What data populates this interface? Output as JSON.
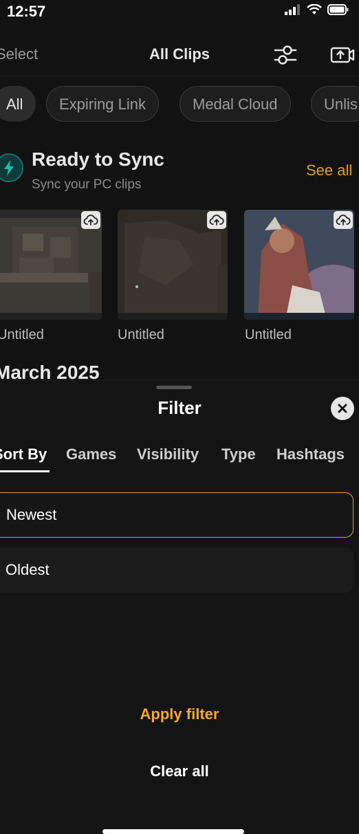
{
  "status": {
    "time": "12:57"
  },
  "nav": {
    "select": "Select",
    "title": "All Clips"
  },
  "chips": [
    {
      "label": "All"
    },
    {
      "label": "Expiring Link"
    },
    {
      "label": "Medal Cloud"
    },
    {
      "label": "Unlis"
    }
  ],
  "sync": {
    "title": "Ready to Sync",
    "subtitle": "Sync your PC clips",
    "see_all": "See all",
    "clips": [
      {
        "title": "Untitled"
      },
      {
        "title": "Untitled"
      },
      {
        "title": "Untitled"
      }
    ]
  },
  "month": "March 2025",
  "filter": {
    "title": "Filter",
    "tabs": [
      {
        "label": "Sort By"
      },
      {
        "label": "Games"
      },
      {
        "label": "Visibility"
      },
      {
        "label": "Type"
      },
      {
        "label": "Hashtags"
      }
    ],
    "active_tab": "Sort By",
    "options": [
      {
        "label": "Newest",
        "selected": true
      },
      {
        "label": "Oldest",
        "selected": false
      }
    ],
    "apply_label": "Apply filter",
    "clear_label": "Clear all"
  },
  "colors": {
    "accent": "#e0a02a",
    "background": "#121212"
  }
}
